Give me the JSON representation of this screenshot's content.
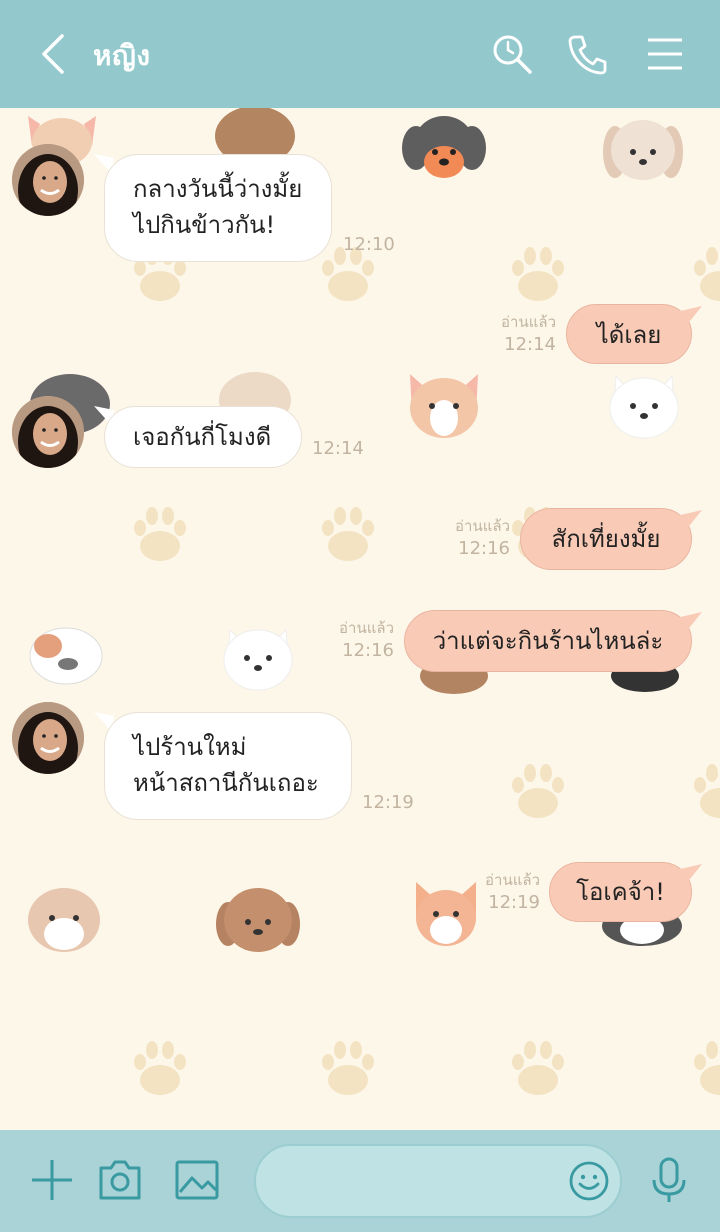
{
  "header": {
    "title": "หญิง",
    "back_icon": "chevron-left-icon",
    "icons": [
      "search-icon",
      "phone-icon",
      "menu-icon"
    ]
  },
  "messages": [
    {
      "side": "in",
      "lines": [
        "กลางวันนี้ว่างมั้ย",
        "ไปกินข้าวกัน!"
      ],
      "time": "12:10"
    },
    {
      "side": "out",
      "lines": [
        "ได้เลย"
      ],
      "read": "อ่านแล้ว",
      "time": "12:14"
    },
    {
      "side": "in",
      "lines": [
        "เจอกันกี่โมงดี"
      ],
      "time": "12:14"
    },
    {
      "side": "out",
      "lines": [
        "สักเที่ยงมั้ย"
      ],
      "read": "อ่านแล้ว",
      "time": "12:16"
    },
    {
      "side": "out",
      "lines": [
        "ว่าแต่จะกินร้านไหนล่ะ"
      ],
      "read": "อ่านแล้ว",
      "time": "12:16"
    },
    {
      "side": "in",
      "lines": [
        "ไปร้านใหม่",
        "หน้าสถานีกันเถอะ"
      ],
      "time": "12:19"
    },
    {
      "side": "out",
      "lines": [
        "โอเคจ้า!"
      ],
      "read": "อ่านแล้ว",
      "time": "12:19"
    }
  ],
  "footer": {
    "icons": [
      "plus-icon",
      "camera-icon",
      "image-icon",
      "smiley-icon",
      "microphone-icon"
    ],
    "input_value": ""
  },
  "colors": {
    "header_bg": "#93c9cc",
    "chat_bg": "#fdf7ea",
    "outgoing_bubble": "#f9cbb7",
    "incoming_bubble": "#ffffff",
    "footer_bg": "#a9d3d7"
  }
}
